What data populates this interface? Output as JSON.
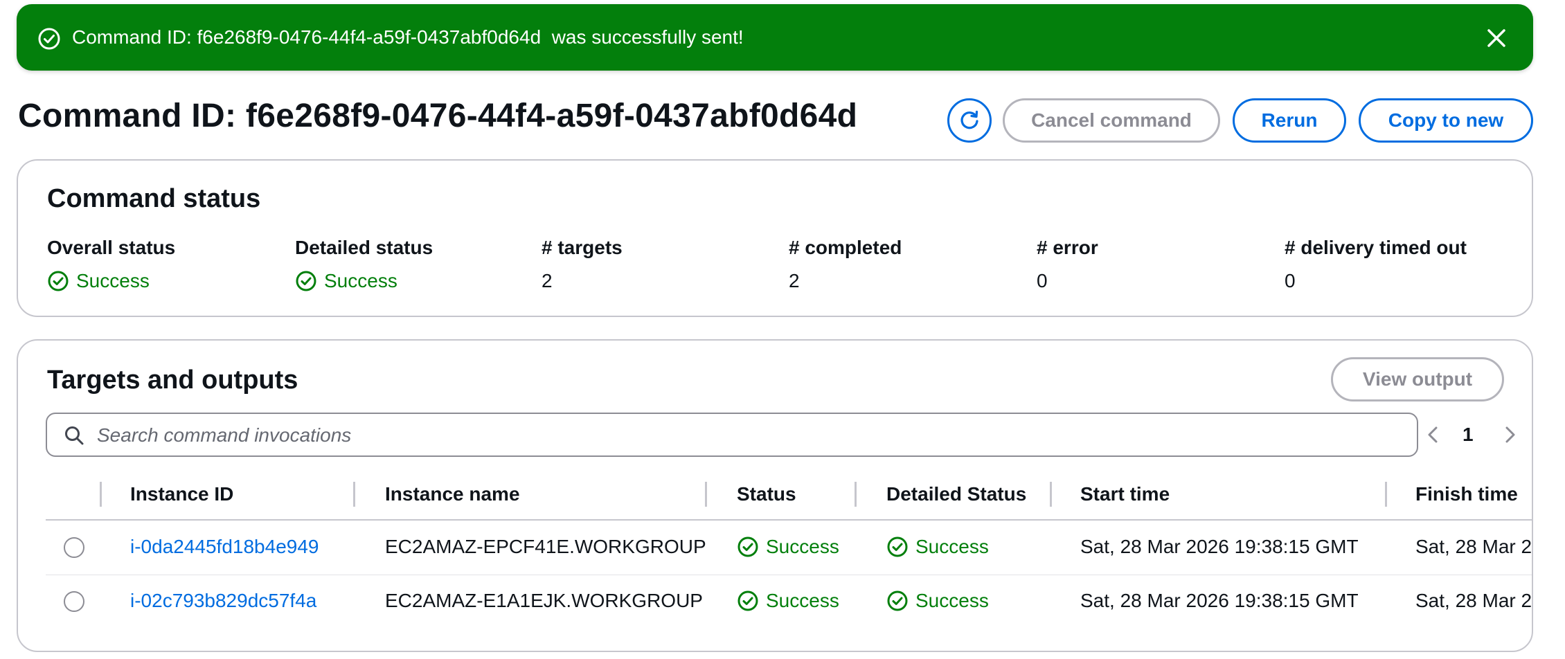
{
  "flash": {
    "message": "Command ID: f6e268f9-0476-44f4-a59f-0437abf0d64d  was successfully sent!",
    "color": "#037f0c"
  },
  "header": {
    "title": "Command ID: f6e268f9-0476-44f4-a59f-0437abf0d64d",
    "cancel_label": "Cancel command",
    "rerun_label": "Rerun",
    "copy_label": "Copy to new"
  },
  "command_status": {
    "heading": "Command status",
    "fields": [
      {
        "label": "Overall status",
        "value": "Success",
        "type": "status"
      },
      {
        "label": "Detailed status",
        "value": "Success",
        "type": "status"
      },
      {
        "label": "# targets",
        "value": "2",
        "type": "text"
      },
      {
        "label": "# completed",
        "value": "2",
        "type": "text"
      },
      {
        "label": "# error",
        "value": "0",
        "type": "text"
      },
      {
        "label": "# delivery timed out",
        "value": "0",
        "type": "text"
      }
    ]
  },
  "targets": {
    "heading": "Targets and outputs",
    "view_output_label": "View output",
    "search_placeholder": "Search command invocations",
    "page": "1",
    "columns": [
      "Instance ID",
      "Instance name",
      "Status",
      "Detailed Status",
      "Start time",
      "Finish time"
    ],
    "rows": [
      {
        "instance_id": "i-0da2445fd18b4e949",
        "instance_name": "EC2AMAZ-EPCF41E.WORKGROUP",
        "status": "Success",
        "detailed_status": "Success",
        "start_time": "Sat, 28 Mar 2026 19:38:15 GMT",
        "finish_time": "Sat, 28 Mar 2"
      },
      {
        "instance_id": "i-02c793b829dc57f4a",
        "instance_name": "EC2AMAZ-E1A1EJK.WORKGROUP",
        "status": "Success",
        "detailed_status": "Success",
        "start_time": "Sat, 28 Mar 2026 19:38:15 GMT",
        "finish_time": "Sat, 28 Mar 2"
      }
    ]
  },
  "colors": {
    "success": "#037f0c",
    "link": "#006ce0",
    "disabled": "#8c8c94"
  }
}
